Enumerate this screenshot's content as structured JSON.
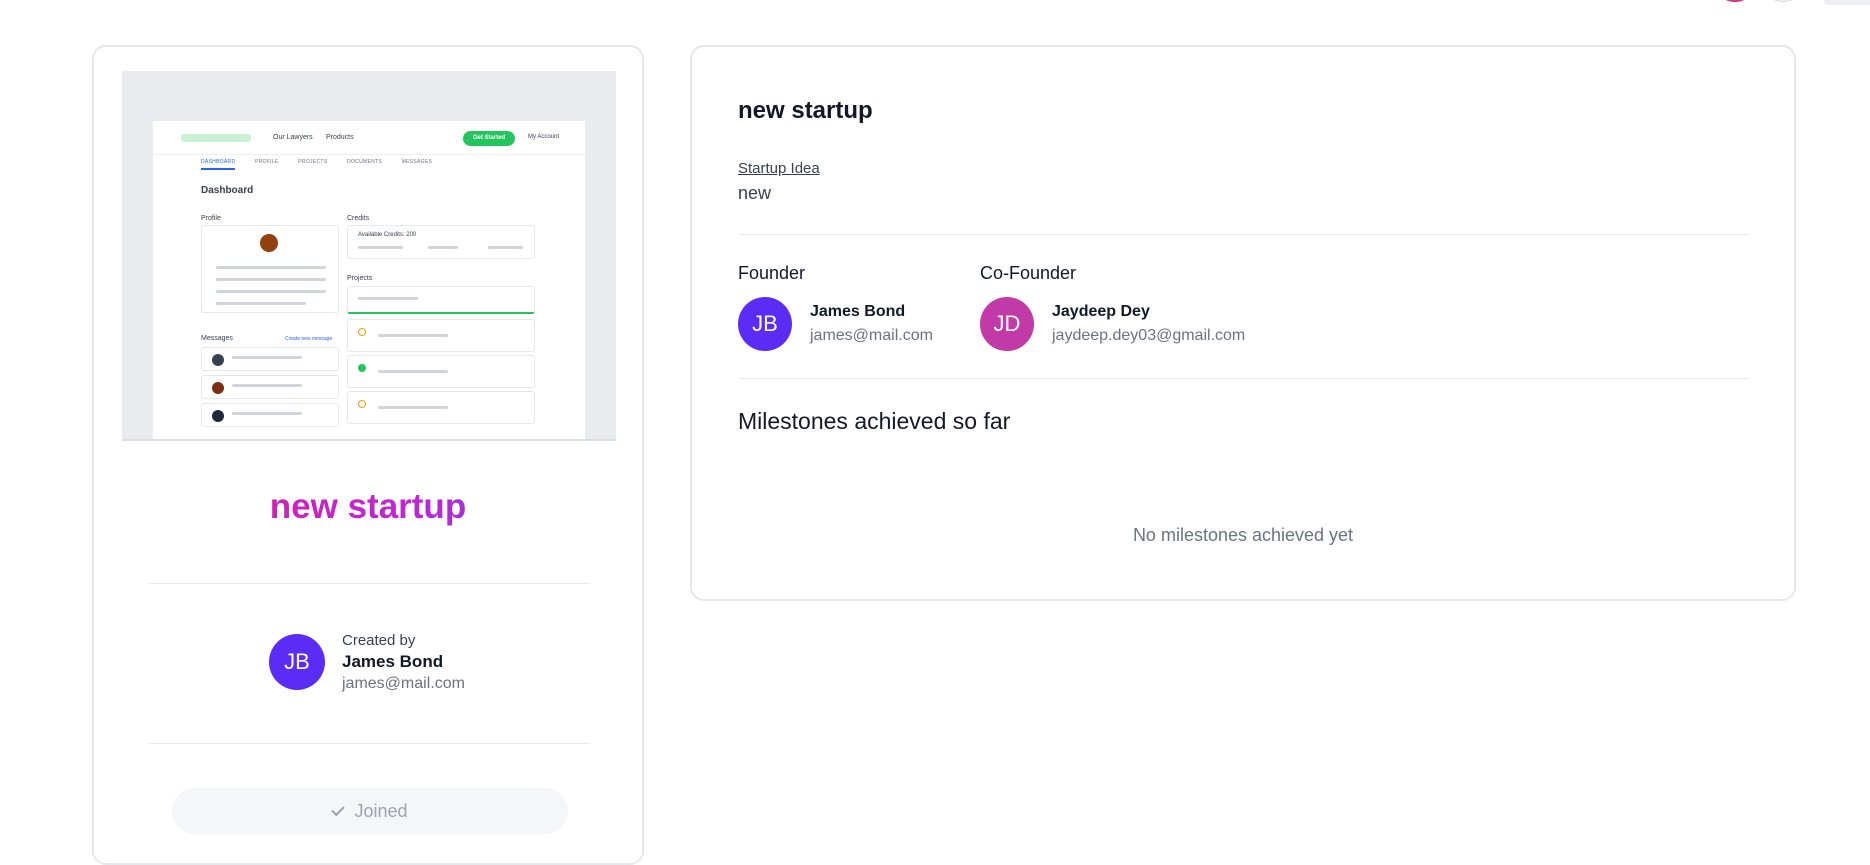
{
  "startup": {
    "name": "new startup",
    "idea_label": "Startup Idea",
    "idea_value": "new"
  },
  "preview": {
    "nav_links": [
      "Our Lawyers",
      "Products"
    ],
    "cta_label": "Get Started",
    "account_label": "My Account",
    "tabs": [
      "DASHBOARD",
      "PROFILE",
      "PROJECTS",
      "DOCUMENTS",
      "MESSAGES"
    ],
    "heading": "Dashboard",
    "profile_label": "Profile",
    "credits_label": "Credits",
    "available_credits": "Available Credits:  200",
    "projects_label": "Projects",
    "messages_label": "Messages",
    "create_message": "Create new message"
  },
  "creator": {
    "label": "Created by",
    "initials": "JB",
    "name": "James Bond",
    "email": "james@mail.com"
  },
  "join_button": {
    "label": "Joined"
  },
  "founder": {
    "label": "Founder",
    "initials": "JB",
    "name": "James Bond",
    "email": "james@mail.com"
  },
  "cofounder": {
    "label": "Co-Founder",
    "initials": "JD",
    "name": "Jaydeep Dey",
    "email": "jaydeep.dey03@gmail.com"
  },
  "milestones": {
    "title": "Milestones achieved so far",
    "empty_text": "No milestones achieved yet"
  },
  "colors": {
    "avatar_jb": "#5b2cf5",
    "avatar_jd": "#c23aa8",
    "title_gradient_start": "#e11d8f",
    "title_gradient_end": "#7c3aed"
  }
}
